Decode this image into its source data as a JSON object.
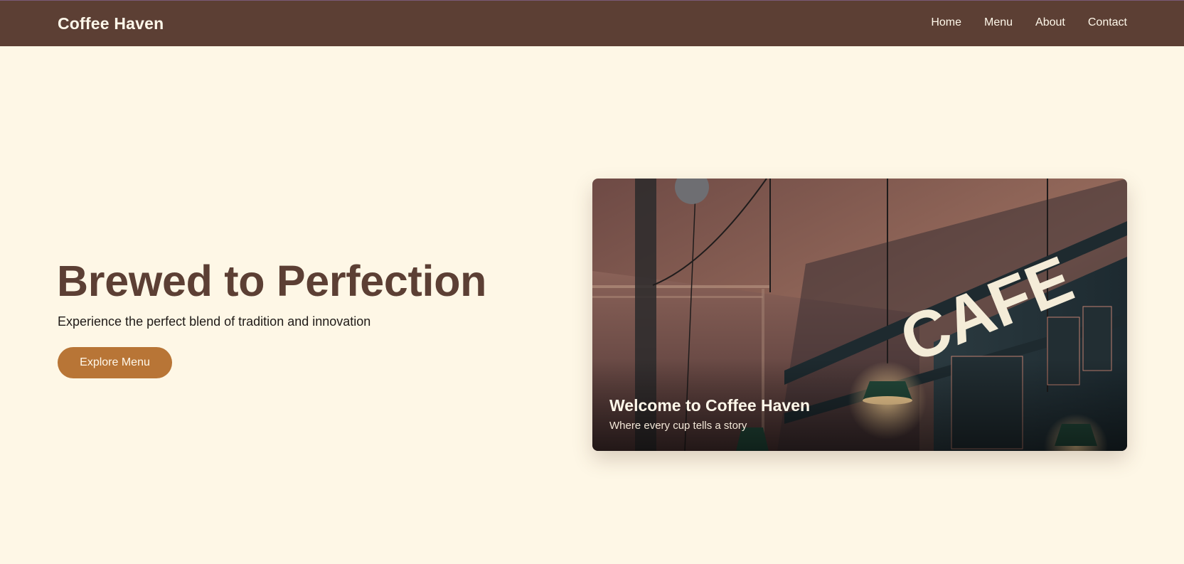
{
  "header": {
    "brand": "Coffee Haven",
    "nav": [
      {
        "label": "Home"
      },
      {
        "label": "Menu"
      },
      {
        "label": "About"
      },
      {
        "label": "Contact"
      }
    ]
  },
  "hero": {
    "title": "Brewed to Perfection",
    "subtitle": "Experience the perfect blend of tradition and innovation",
    "cta_label": "Explore Menu"
  },
  "card": {
    "title": "Welcome to Coffee Haven",
    "subtitle": "Where every cup tells a story",
    "photo_sign": "CAFE"
  },
  "colors": {
    "nav_bg": "#5c3f34",
    "page_bg": "#fef7e6",
    "accent": "#b87536",
    "heading": "#5c3f34"
  }
}
